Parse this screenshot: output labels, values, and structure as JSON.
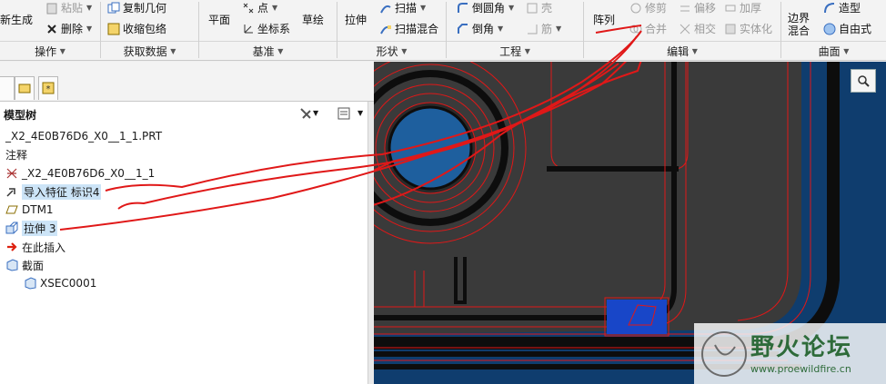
{
  "ribbon": {
    "buttons": {
      "regenerate": "新生成",
      "paste": "粘贴",
      "delete": "删除",
      "copy_geom": "复制几何",
      "shrinkwrap": "收缩包络",
      "plane": "平面",
      "point": "点",
      "csys": "坐标系",
      "sketch": "草绘",
      "extrude": "拉伸",
      "sweep": "扫描",
      "swept_blend": "扫描混合",
      "round": "倒圆角",
      "chamfer": "倒角",
      "shell": "壳",
      "rib": "筋",
      "pattern": "阵列",
      "trim": "修剪",
      "merge": "合并",
      "offset": "偏移",
      "intersect": "相交",
      "thicken": "加厚",
      "solidify": "实体化",
      "boundary_blend": "边界混合",
      "style": "造型",
      "freestyle": "自由式"
    },
    "groups": [
      "操作",
      "获取数据",
      "基准",
      "形状",
      "工程",
      "编辑",
      "曲面"
    ]
  },
  "panel": {
    "title": "模型树",
    "items": [
      {
        "label": "_X2_4E0B76D6_X0__1_1.PRT"
      },
      {
        "label": "注释"
      },
      {
        "label": "_X2_4E0B76D6_X0__1_1"
      },
      {
        "label": "导入特征 标识4"
      },
      {
        "label": "DTM1"
      },
      {
        "label": "拉伸 3"
      },
      {
        "label": "在此插入"
      },
      {
        "label": "截面"
      },
      {
        "label": "XSEC0001"
      }
    ]
  },
  "watermark": {
    "title": "野火论坛",
    "url": "www.proewildfire.cn"
  },
  "colors": {
    "viewport_bg": "#0f3d6e",
    "model_dark": "#3a3a3a",
    "edge_red": "#e01818",
    "selection": "#cce4f7",
    "highlight_blue": "#1846c8"
  }
}
